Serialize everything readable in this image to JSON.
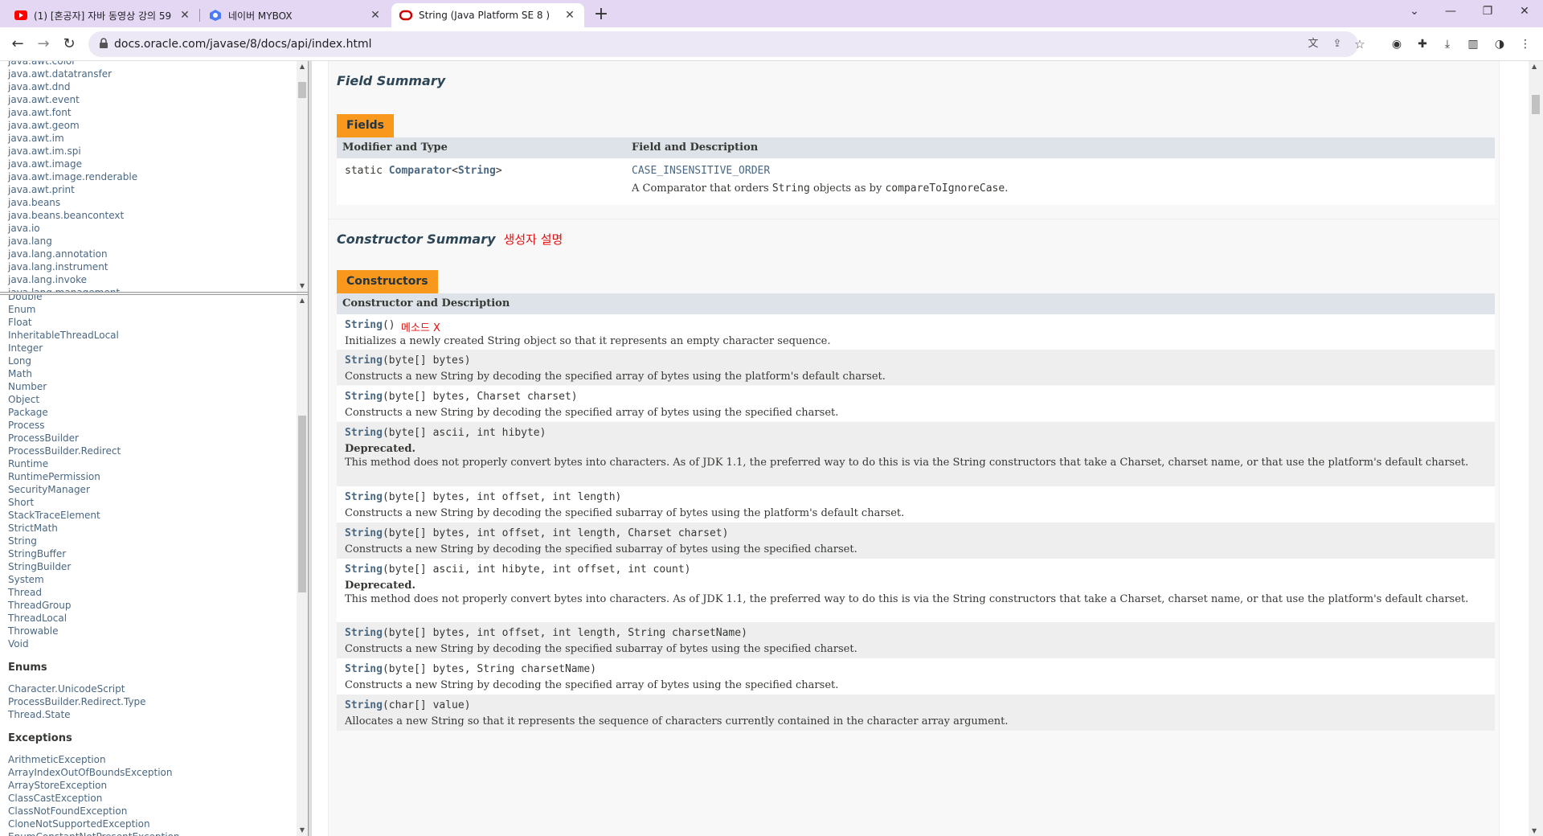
{
  "browser": {
    "tabs": [
      {
        "title": "(1) [혼공자] 자바 동영상 강의 59",
        "favicon": "youtube-icon"
      },
      {
        "title": "네이버 MYBOX",
        "favicon": "mybox-icon"
      },
      {
        "title": "String (Java Platform SE 8 )",
        "favicon": "oracle-icon",
        "active": true
      }
    ],
    "url": "docs.oracle.com/javase/8/docs/api/index.html"
  },
  "packages": [
    "java.awt.color",
    "java.awt.datatransfer",
    "java.awt.dnd",
    "java.awt.event",
    "java.awt.font",
    "java.awt.geom",
    "java.awt.im",
    "java.awt.im.spi",
    "java.awt.image",
    "java.awt.image.renderable",
    "java.awt.print",
    "java.beans",
    "java.beans.beancontext",
    "java.io",
    "java.lang",
    "java.lang.annotation",
    "java.lang.instrument",
    "java.lang.invoke",
    "java.lang.management"
  ],
  "classes": [
    "Double",
    "Enum",
    "Float",
    "InheritableThreadLocal",
    "Integer",
    "Long",
    "Math",
    "Number",
    "Object",
    "Package",
    "Process",
    "ProcessBuilder",
    "ProcessBuilder.Redirect",
    "Runtime",
    "RuntimePermission",
    "SecurityManager",
    "Short",
    "StackTraceElement",
    "StrictMath",
    "String",
    "StringBuffer",
    "StringBuilder",
    "System",
    "Thread",
    "ThreadGroup",
    "ThreadLocal",
    "Throwable",
    "Void"
  ],
  "enums_heading": "Enums",
  "enums": [
    "Character.UnicodeScript",
    "ProcessBuilder.Redirect.Type",
    "Thread.State"
  ],
  "exceptions_heading": "Exceptions",
  "exceptions": [
    "ArithmeticException",
    "ArrayIndexOutOfBoundsException",
    "ArrayStoreException",
    "ClassCastException",
    "ClassNotFoundException",
    "CloneNotSupportedException",
    "EnumConstantNotPresentException"
  ],
  "field_summary": {
    "title": "Field Summary",
    "caption": "Fields",
    "col1": "Modifier and Type",
    "col2": "Field and Description",
    "modifier": "static ",
    "type_link": "Comparator",
    "type_lt": "<",
    "type_param": "String",
    "type_gt": ">",
    "field_name": "CASE_INSENSITIVE_ORDER",
    "desc_a": "A Comparator that orders ",
    "desc_code": "String",
    "desc_b": " objects as by ",
    "desc_code2": "compareToIgnoreCase",
    "desc_c": "."
  },
  "constructor_summary": {
    "title": "Constructor Summary",
    "note": "생성자 설명",
    "caption": "Constructors",
    "col": "Constructor and Description",
    "row0_note": "메소드 X",
    "rows": [
      {
        "name": "String",
        "params": "()",
        "desc": "Initializes a newly created String object so that it represents an empty character sequence."
      },
      {
        "name": "String",
        "params": "(byte[] bytes)",
        "desc": "Constructs a new String by decoding the specified array of bytes using the platform's default charset."
      },
      {
        "name": "String",
        "params": "(byte[] bytes, Charset charset)",
        "desc": "Constructs a new String by decoding the specified array of bytes using the specified charset."
      },
      {
        "name": "String",
        "params": "(byte[] ascii, int hibyte)",
        "deprecated": "Deprecated.",
        "desc": "This method does not properly convert bytes into characters. As of JDK 1.1, the preferred way to do this is via the String constructors that take a Charset, charset name, or that use the platform's default charset."
      },
      {
        "name": "String",
        "params": "(byte[] bytes, int offset, int length)",
        "desc": "Constructs a new String by decoding the specified subarray of bytes using the platform's default charset."
      },
      {
        "name": "String",
        "params": "(byte[] bytes, int offset, int length, Charset charset)",
        "desc": "Constructs a new String by decoding the specified subarray of bytes using the specified charset."
      },
      {
        "name": "String",
        "params": "(byte[] ascii, int hibyte, int offset, int count)",
        "deprecated": "Deprecated.",
        "desc": "This method does not properly convert bytes into characters. As of JDK 1.1, the preferred way to do this is via the String constructors that take a Charset, charset name, or that use the platform's default charset."
      },
      {
        "name": "String",
        "params": "(byte[] bytes, int offset, int length, String charsetName)",
        "desc": "Constructs a new String by decoding the specified subarray of bytes using the specified charset."
      },
      {
        "name": "String",
        "params": "(byte[] bytes, String charsetName)",
        "desc": "Constructs a new String by decoding the specified array of bytes using the specified charset."
      },
      {
        "name": "String",
        "params": "(char[] value)",
        "desc": "Allocates a new String so that it represents the sequence of characters currently contained in the character array argument."
      }
    ]
  },
  "colors": {
    "accent": "#f8981d",
    "link": "#4a6782",
    "header_bg": "#dee3e9",
    "note": "#e01010",
    "tabbar": "#e3d7f4"
  }
}
